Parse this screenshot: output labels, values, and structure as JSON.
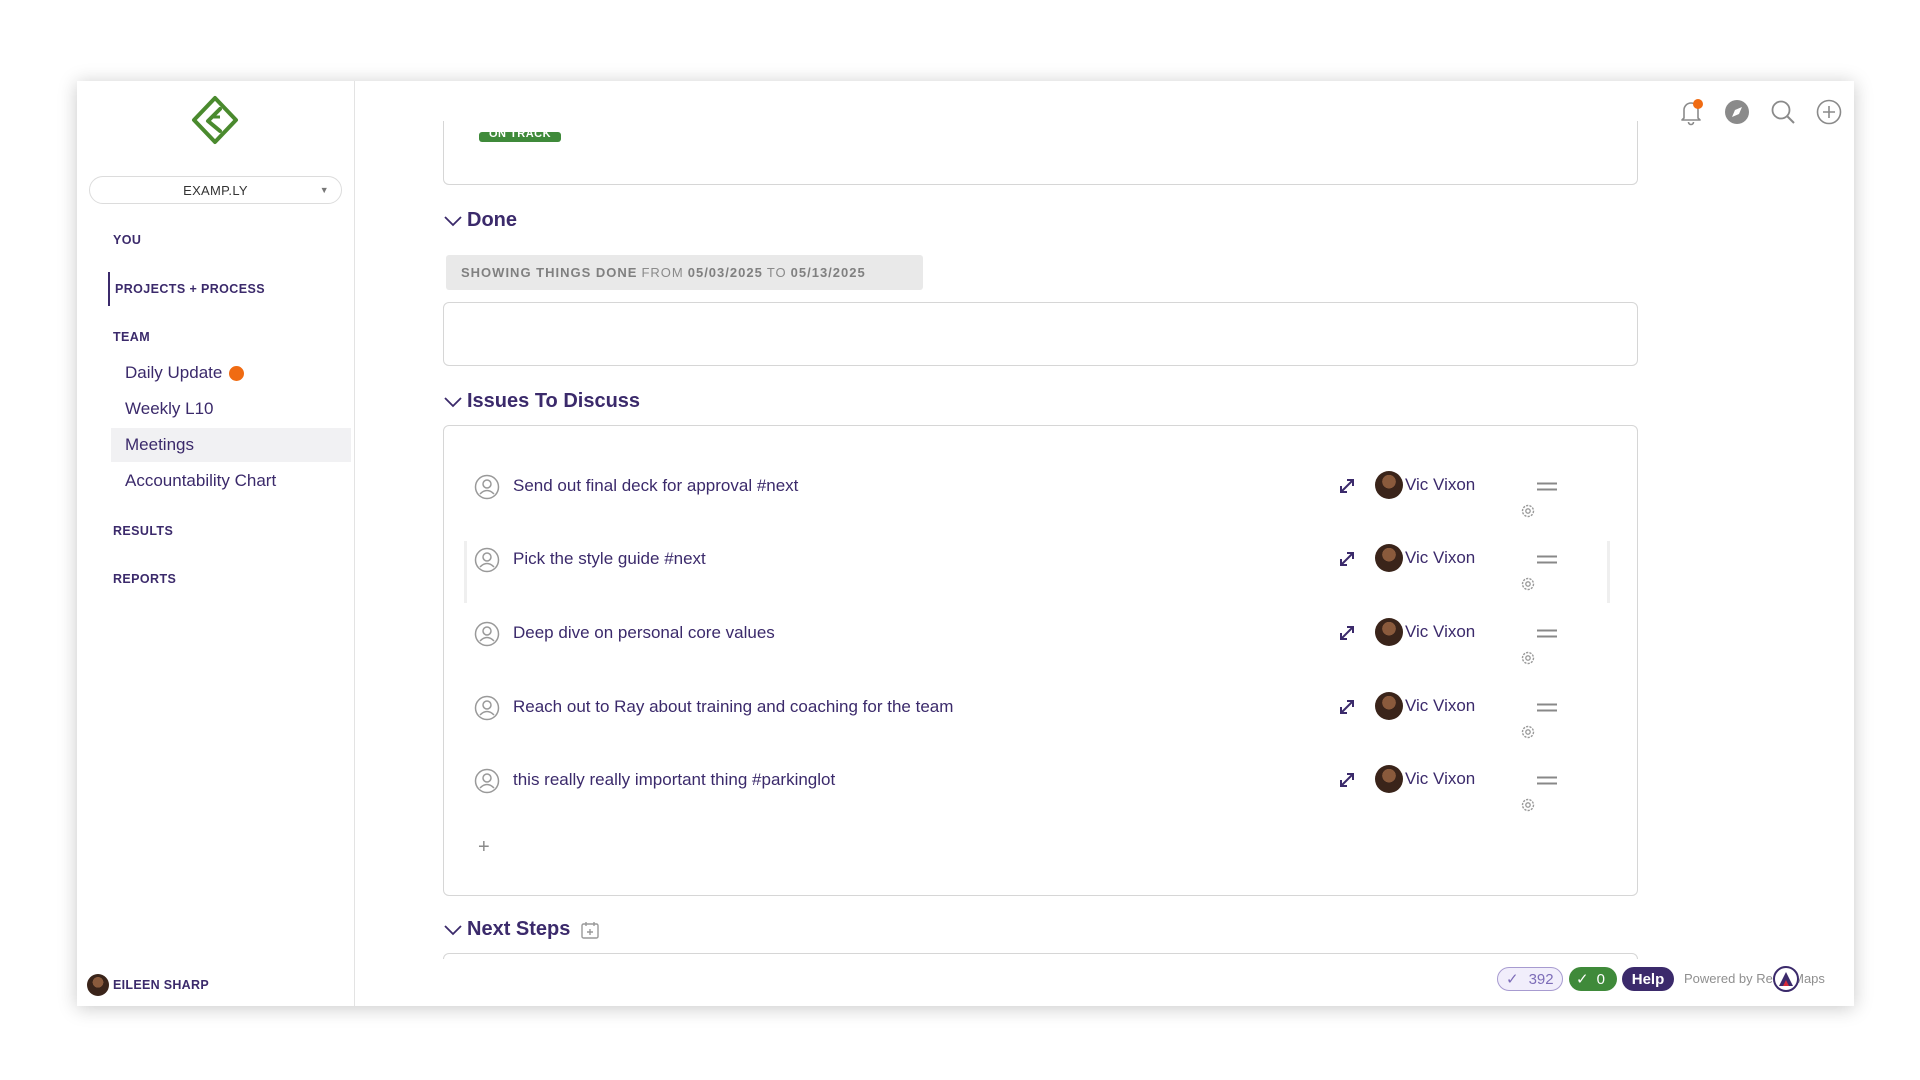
{
  "sidebar": {
    "org_name": "EXAMP.LY",
    "sections": {
      "you": "YOU",
      "projects": "PROJECTS + PROCESS",
      "team": "TEAM",
      "results": "RESULTS",
      "reports": "REPORTS"
    },
    "team_items": [
      {
        "label": "Daily Update"
      },
      {
        "label": "Weekly L10"
      },
      {
        "label": "Meetings"
      },
      {
        "label": "Accountability Chart"
      }
    ],
    "user_name": "EILEEN SHARP"
  },
  "main": {
    "status_badge": "ON TRACK",
    "done": {
      "title": "Done",
      "filter_prefix": "SHOWING THINGS DONE",
      "from_label": "FROM",
      "from_date": "05/03/2025",
      "to_label": "TO",
      "to_date": "05/13/2025"
    },
    "issues": {
      "title": "Issues To Discuss",
      "items": [
        {
          "text": "Send out final deck for approval #next",
          "owner": "Vic Vixon"
        },
        {
          "text": "Pick the style guide #next",
          "owner": "Vic Vixon"
        },
        {
          "text": "Deep dive on personal core values",
          "owner": "Vic Vixon"
        },
        {
          "text": "Reach out to Ray about training and coaching for the team",
          "owner": "Vic Vixon"
        },
        {
          "text": "this really really important thing #parkinglot",
          "owner": "Vic Vixon"
        }
      ],
      "add_label": "+"
    },
    "next_steps": {
      "title": "Next Steps"
    }
  },
  "footer": {
    "count_value": "392",
    "done_value": "0",
    "help_label": "Help",
    "powered_by": "Powered by ResultMaps"
  },
  "colors": {
    "brand_purple": "#3b2a6b",
    "accent_orange": "#f06b12",
    "on_track_green": "#3f8a3a",
    "logo_green": "#4a8a2e"
  }
}
